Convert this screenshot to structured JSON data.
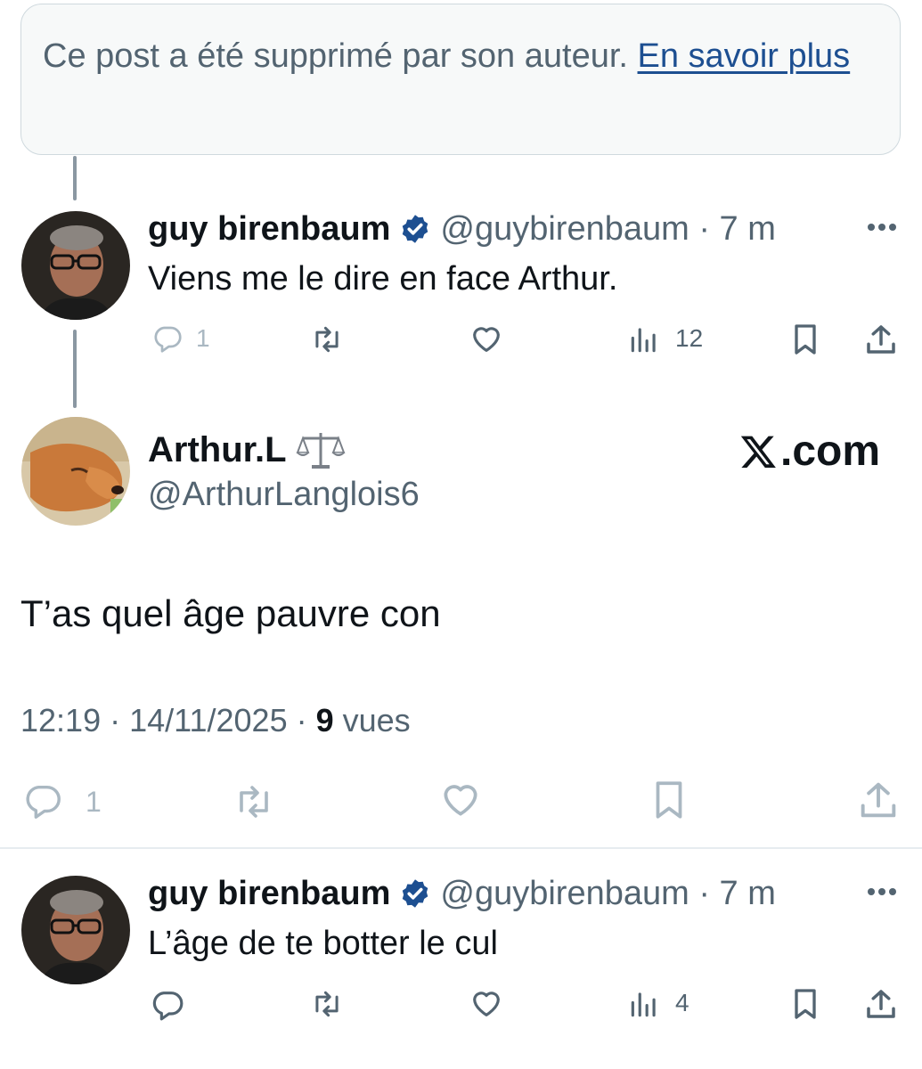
{
  "deleted_notice": {
    "text": "Ce post a été supprimé par son auteur. ",
    "link": "En savoir plus"
  },
  "reply1": {
    "name": "guy birenbaum",
    "meta": "@guybirenbaum · 7 m",
    "text": "Viens me le dire en face Arthur.",
    "reply_count": "1",
    "view_count": "12"
  },
  "main_post": {
    "name": "Arthur.L",
    "handle": "@ArthurLanglois6",
    "watermark": "X.com",
    "watermark_suffix": ".com",
    "text": "T’as quel âge pauvre con",
    "time": "12:19 · 14/11/2025 · ",
    "views_number": "9",
    "views_label": " vues",
    "reply_count": "1"
  },
  "reply2": {
    "name": "guy birenbaum",
    "meta": "@guybirenbaum · 7 m",
    "text": "L’âge de te botter le cul",
    "view_count": "4"
  },
  "colors": {
    "verified_blue": "#1d4f91",
    "text_primary": "#0f1419",
    "text_secondary": "#536471",
    "icon_gray": "#536471",
    "icon_light": "#aab8c2",
    "link": "#1d4f91"
  },
  "icons": [
    "reply-icon",
    "repost-icon",
    "like-icon",
    "views-icon",
    "bookmark-icon",
    "share-icon",
    "verified-badge-icon",
    "more-icon",
    "scale-emoji-icon",
    "x-logo-icon"
  ]
}
